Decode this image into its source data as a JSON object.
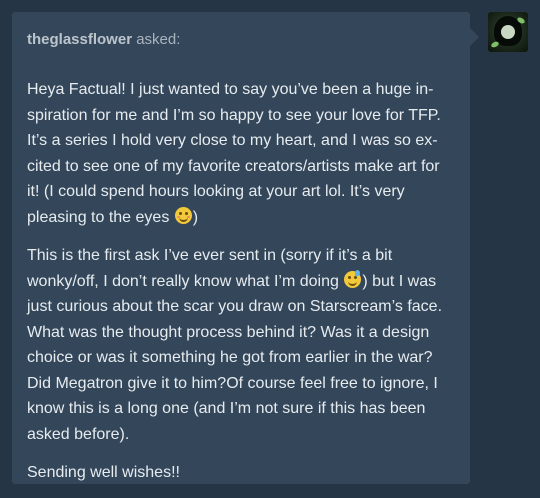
{
  "ask": {
    "asker": "theglassflower",
    "asked_label": " asked:",
    "paragraphs": [
      {
        "text_before_emoji": "Heya Factual! I just wanted to say you’ve been a huge in-spiration for me and I’m so happy to see your love for TFP. It’s a series I hold very close to my heart, and I was so ex-cited to see one of my favorite creators/artists make art for it! (I could spend hours looking at your art lol. It’s very pleasing to the eyes ",
        "emoji": "smiling-face-emoji",
        "text_after_emoji": ")"
      },
      {
        "text_before_emoji": "This is the first ask I’ve ever sent in (sorry if it’s a bit wonky/off, I don’t really know what I’m doing ",
        "emoji": "sweat-smile-emoji",
        "text_after_emoji": ") but I was just curious about the scar you draw on Starscream’s face. What was the thought process behind it? Was it a design choice or was it something he got from earlier in the war? Did Megatron give it to him?Of course feel free to ignore, I know this is a long one (and I’m not sure if this has been asked before)."
      },
      {
        "text": "Sending well wishes!!"
      }
    ]
  },
  "avatar": {
    "icon": "user-avatar"
  },
  "colors": {
    "background": "#263546",
    "card": "#34475a",
    "text": "#e6ebef",
    "muted": "#a9b3bd"
  }
}
